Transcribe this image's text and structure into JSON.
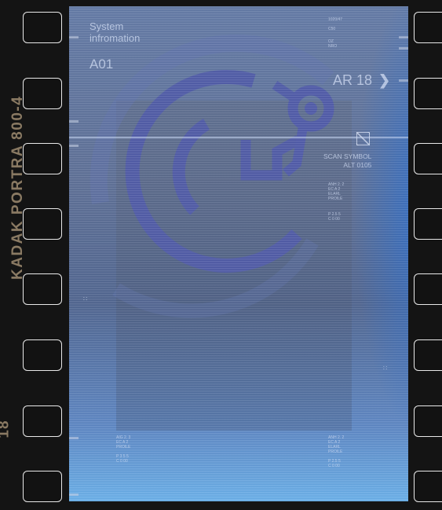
{
  "film": {
    "brand": "KADAK PORTRA 800-4",
    "frame_number": "18"
  },
  "hud": {
    "system_line1": "System",
    "system_line2": "infromation",
    "code": "A01",
    "ar_label": "AR 18",
    "top_right_line1": "1020/47",
    "top_right_line2": "C50",
    "top_right_line3": "OZ",
    "top_right_line4": "NRO",
    "scan_line1": "SCAN SYMBOL",
    "scan_line2": "ALT 0105",
    "readout_a_line1": "ANH     2. 2",
    "readout_a_line2": "EC       A 2",
    "readout_a_line3": "ELARL",
    "readout_a_line4": "PROILE",
    "readout_b_line1": "P           2.5 5",
    "readout_b_line2": "C           0  00",
    "bottom_left_line1": "AIG     2. 3",
    "bottom_left_line2": "EC       A 2",
    "bottom_left_line3": "PROILE",
    "bottom_left_line4": "P       3 5 5",
    "bottom_left_line5": "C       0  00",
    "bottom_right_line1": "ANH     2. 2",
    "bottom_right_line2": "EC       A 2",
    "bottom_right_line3": "ELARL",
    "bottom_right_line4": "PROILE",
    "bottom_right_line5": "P         2.5 5",
    "bottom_right_line6": "C         0  00"
  },
  "colors": {
    "film_base": "#141414",
    "brand_text": "#8a7a63",
    "logo": "#4f5aa8",
    "hud_text": "#d2def5"
  }
}
